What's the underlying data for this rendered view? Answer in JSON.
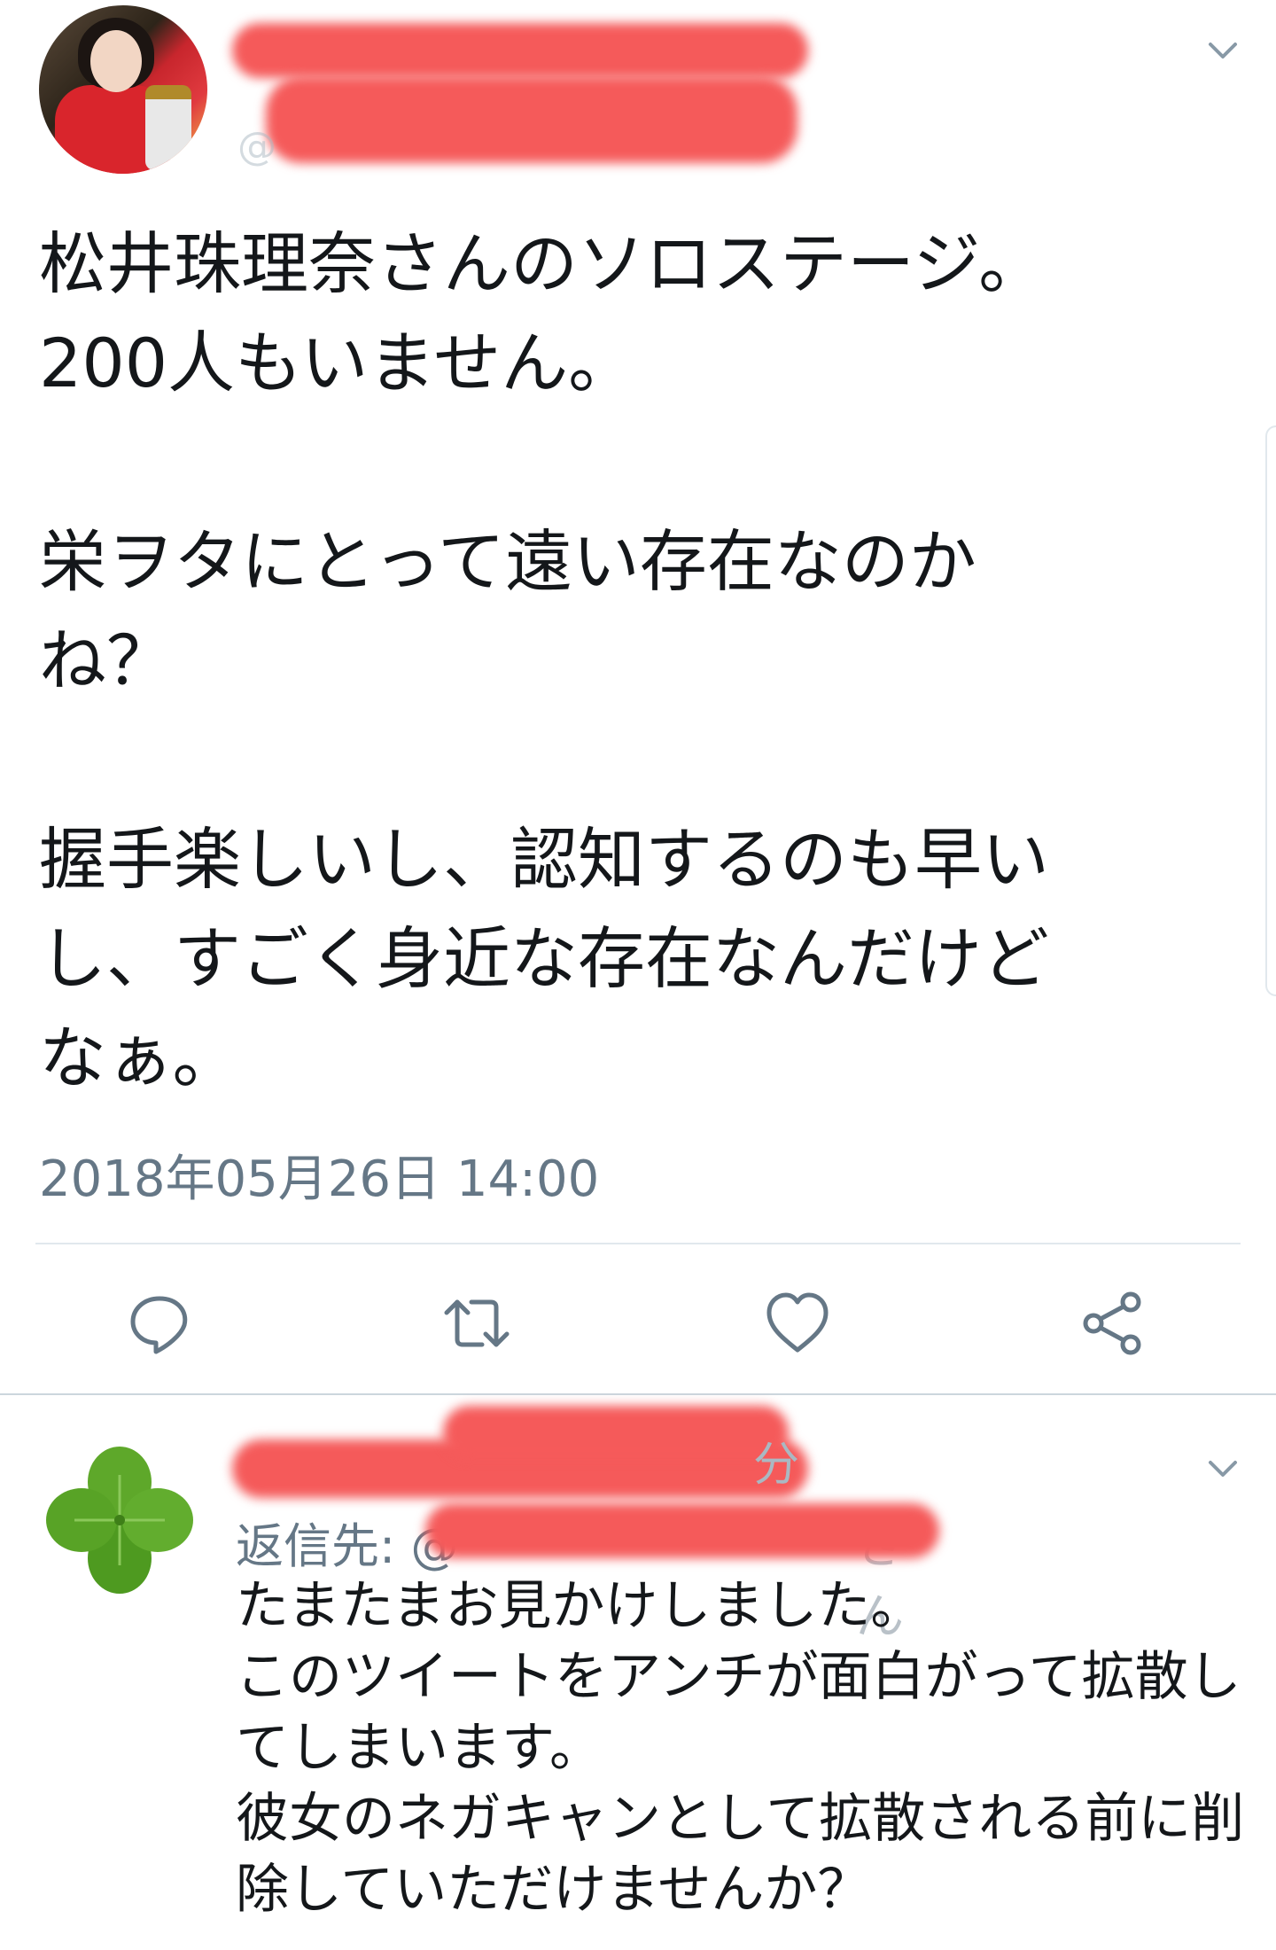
{
  "main_tweet": {
    "author_handle_prefix": "@",
    "text": "松井珠理奈さんのソロステージ。\n200人もいません。\n\n栄ヲタにとって遠い存在なのか\nね？\n\n握手楽しいし、認知するのも早い\nし、すごく身近な存在なんだけど\nなぁ。",
    "timestamp": "2018年05月26日 14:00",
    "menu_icon": "chevron-down-icon",
    "actions": [
      {
        "name": "reply-button",
        "icon": "reply-icon"
      },
      {
        "name": "retweet-button",
        "icon": "retweet-icon"
      },
      {
        "name": "like-button",
        "icon": "heart-icon"
      },
      {
        "name": "share-button",
        "icon": "share-icon"
      }
    ]
  },
  "reply_tweet": {
    "time_suffix": "分",
    "reply_to_label": "返信先: @",
    "reply_to_suffix": "さん",
    "text": "たまたまお見かけしました。\nこのツイートをアンチが面白がって拡散し\nてしまいます。\n彼女のネガキャンとして拡散される前に削\n除していただけませんか？",
    "menu_icon": "chevron-down-icon"
  },
  "colors": {
    "text_primary": "#14171a",
    "text_secondary": "#657786",
    "icon": "#657786",
    "redaction": "#f55a5a",
    "divider": "#e1e8ed"
  }
}
